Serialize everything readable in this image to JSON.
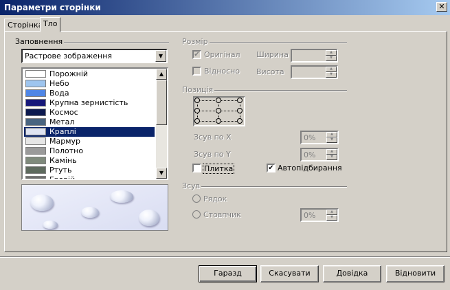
{
  "window": {
    "title": "Параметри сторінки",
    "close_glyph": "✕"
  },
  "tabs": [
    {
      "label": "Сторінка"
    },
    {
      "label": "Тло"
    }
  ],
  "fill": {
    "group_label": "Заповнення",
    "dropdown_value": "Растрове зображення",
    "items": [
      {
        "label": "Порожній",
        "swatch": "#ffffff"
      },
      {
        "label": "Небо",
        "swatch": "#9ec5ef"
      },
      {
        "label": "Вода",
        "swatch": "#4f86e6"
      },
      {
        "label": "Крупна зернистість",
        "swatch": "#17187a"
      },
      {
        "label": "Космос",
        "swatch": "#0d1a4f"
      },
      {
        "label": "Метал",
        "swatch": "#4a6580"
      },
      {
        "label": "Краплі",
        "swatch": "#dfe4f2"
      },
      {
        "label": "Мармур",
        "swatch": "#e6e6e6"
      },
      {
        "label": "Полотно",
        "swatch": "#9a9a9a"
      },
      {
        "label": "Камінь",
        "swatch": "#7f8a7c"
      },
      {
        "label": "Ртуть",
        "swatch": "#5e6a5e"
      },
      {
        "label": "Гравій",
        "swatch": "#6c6c6c"
      }
    ],
    "selected_index": 6
  },
  "size": {
    "group_label": "Розмір",
    "original_label": "Оригінал",
    "relative_label": "Відносно",
    "width_label": "Ширина",
    "height_label": "Висота"
  },
  "position": {
    "group_label": "Позиція",
    "offset_x_label": "Зсув по X",
    "offset_y_label": "Зсув по Y",
    "offset_x_value": "0%",
    "offset_y_value": "0%",
    "tile_label": "Плитка",
    "autofit_label": "Автопідбирання"
  },
  "offset": {
    "group_label": "Зсув",
    "row_label": "Рядок",
    "column_label": "Стовпчик",
    "value": "0%"
  },
  "buttons": {
    "ok": "Гаразд",
    "cancel": "Скасувати",
    "help": "Довідка",
    "reset": "Відновити"
  }
}
